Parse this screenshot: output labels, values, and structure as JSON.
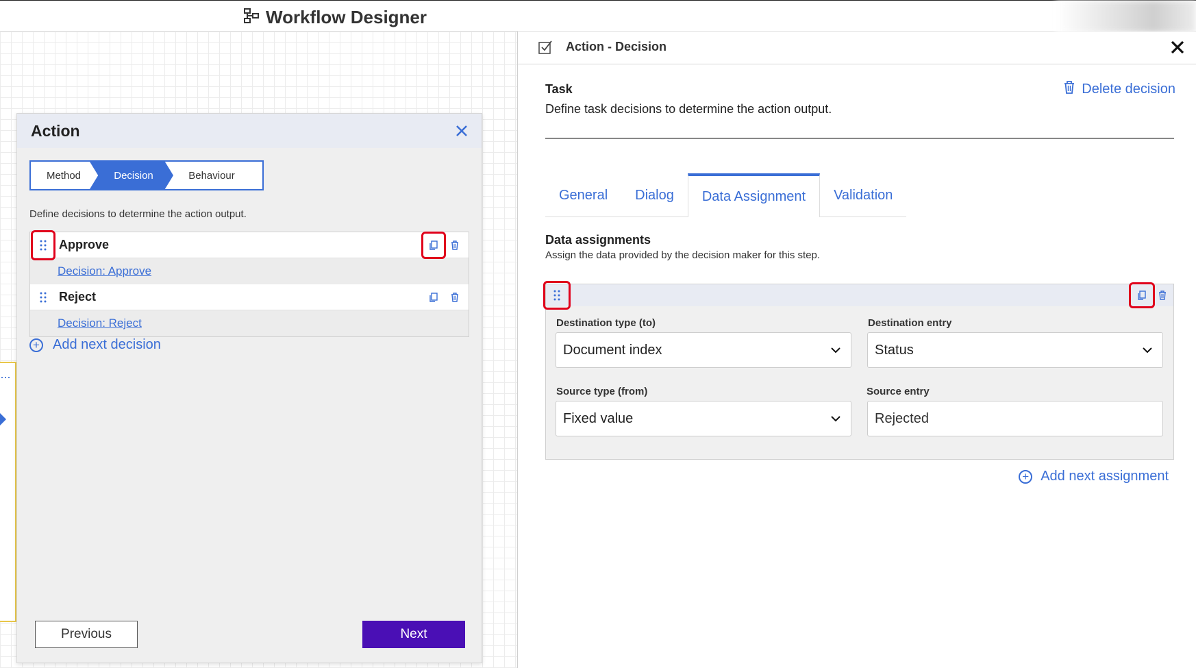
{
  "app": {
    "title": "Workflow Designer"
  },
  "action_panel": {
    "title": "Action",
    "steps": [
      "Method",
      "Decision",
      "Behaviour"
    ],
    "active_step": "Decision",
    "description": "Define decisions to determine the action output.",
    "decisions": [
      {
        "name": "Approve",
        "link": "Decision: Approve"
      },
      {
        "name": "Reject",
        "link": "Decision: Reject"
      }
    ],
    "add_label": "Add next decision",
    "previous_label": "Previous",
    "next_label": "Next"
  },
  "detail_panel": {
    "title": "Action - Decision",
    "task_label": "Task",
    "task_description": "Define task decisions to determine the action output.",
    "delete_label": "Delete decision",
    "tabs": [
      "General",
      "Dialog",
      "Data Assignment",
      "Validation"
    ],
    "active_tab": "Data Assignment",
    "section_title": "Data assignments",
    "section_description": "Assign the data provided by the decision maker for this step.",
    "assignment": {
      "destination_type_label": "Destination type (to)",
      "destination_type_value": "Document index",
      "destination_entry_label": "Destination entry",
      "destination_entry_value": "Status",
      "source_type_label": "Source type (from)",
      "source_type_value": "Fixed value",
      "source_entry_label": "Source entry",
      "source_entry_value": "Rejected"
    },
    "add_assignment_label": "Add next assignment"
  },
  "icons": {
    "app": "workflow-icon",
    "drag": "drag-handle-icon",
    "copy": "copy-icon",
    "delete": "trash-icon",
    "add": "plus-circle-icon",
    "close": "close-icon",
    "task": "checkbox-icon",
    "dropdown": "chevron-down-icon"
  },
  "colors": {
    "accent": "#3a6ed6",
    "primary_button": "#4a0fb5",
    "highlight": "#e0001b"
  }
}
